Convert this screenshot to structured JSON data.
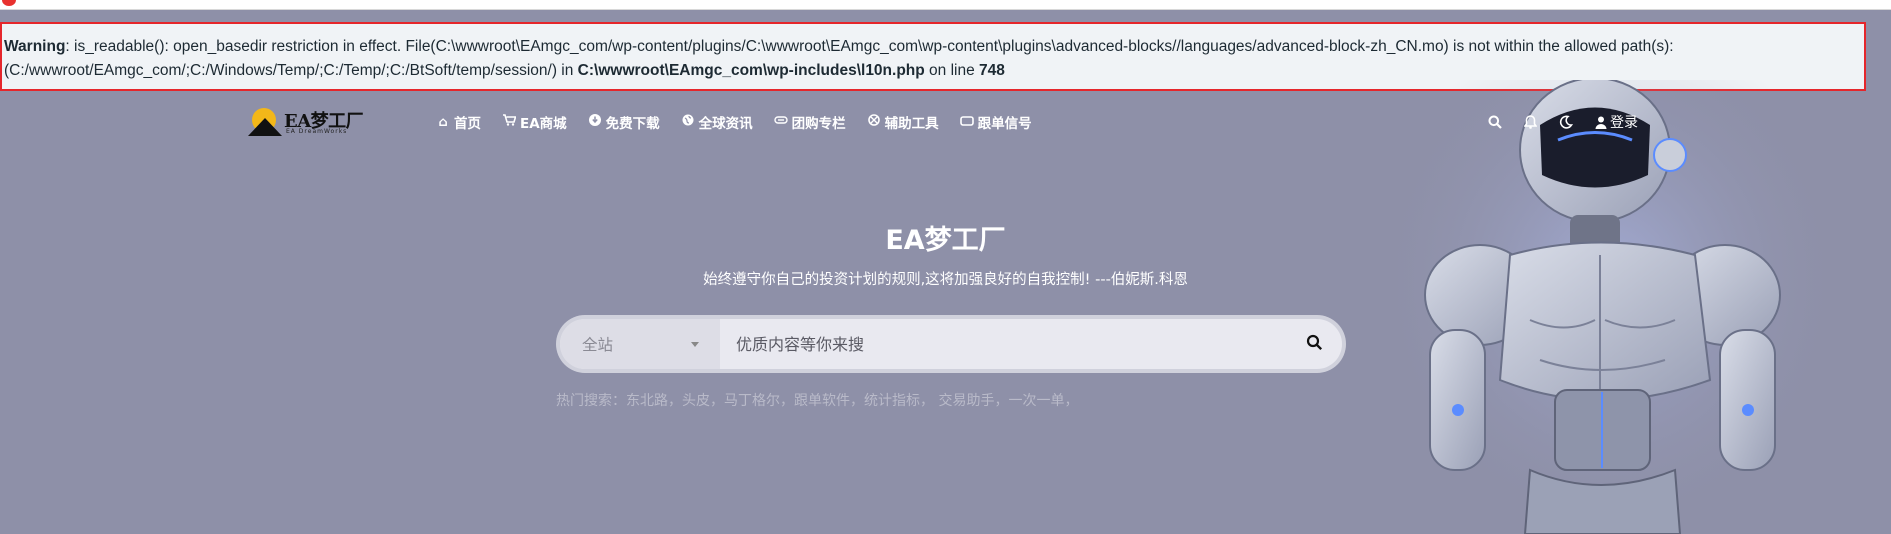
{
  "warning": {
    "label": "Warning",
    "message": ": is_readable(): open_basedir restriction in effect. File(C:\\wwwroot\\EAmgc_com/wp-content/plugins/C:\\wwwroot\\EAmgc_com\\wp-content\\plugins\\advanced-blocks//languages/advanced-block-zh_CN.mo) is not within the allowed path(s): (C:/wwwroot/EAmgc_com/;C:/Windows/Temp/;C:/Temp/;C:/BtSoft/temp/session/) in ",
    "file": "C:\\wwwroot\\EAmgc_com\\wp-includes\\l10n.php",
    "on_line": " on line ",
    "line": "748"
  },
  "logo": {
    "text": "EA梦工厂",
    "sub": "EA DreamWorks"
  },
  "nav": [
    {
      "icon": "home-icon",
      "label": "首页"
    },
    {
      "icon": "cart-icon",
      "label": "EA商城"
    },
    {
      "icon": "download-icon",
      "label": "免费下载"
    },
    {
      "icon": "globe-icon",
      "label": "全球资讯"
    },
    {
      "icon": "group-icon",
      "label": "团购专栏"
    },
    {
      "icon": "tools-icon",
      "label": "辅助工具"
    },
    {
      "icon": "signal-icon",
      "label": "跟单信号"
    }
  ],
  "tools": {
    "login_label": "登录"
  },
  "hero": {
    "title": "EA梦工厂",
    "subtitle": "始终遵守你自己的投资计划的规则,这将加强良好的自我控制! ---伯妮斯.科恩"
  },
  "search": {
    "scope": "全站",
    "placeholder": "优质内容等你来搜"
  },
  "hot": {
    "label": "热门搜索：",
    "items": [
      "东北路，",
      "头皮，",
      "马丁格尔，",
      "跟单软件，",
      "统计指标，",
      " 交易助手，",
      "一次一单，"
    ]
  },
  "colors": {
    "background": "#8e90a8",
    "warning_border": "#e5262b",
    "logo_sun": "#f3b719"
  }
}
